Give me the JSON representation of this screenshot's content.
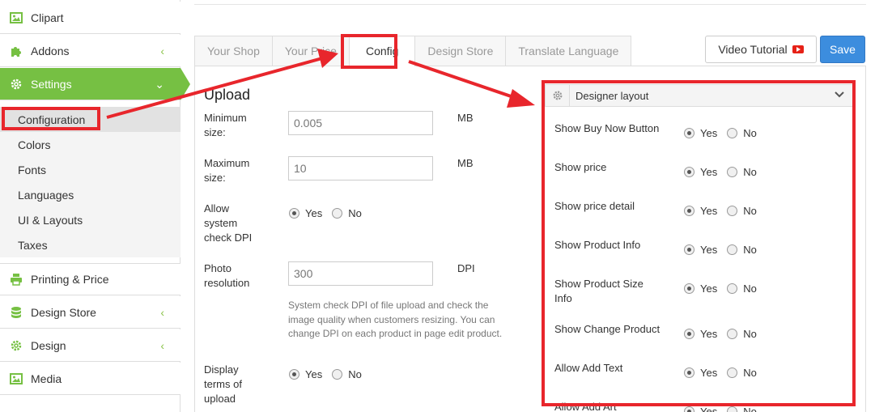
{
  "sidebar": {
    "items": [
      {
        "label": "Clipart",
        "icon": "image-icon"
      },
      {
        "label": "Addons",
        "icon": "puzzle-icon"
      },
      {
        "label": "Settings",
        "icon": "gear-icon"
      },
      {
        "label": "Printing & Price",
        "icon": "printer-icon"
      },
      {
        "label": "Design Store",
        "icon": "database-icon"
      },
      {
        "label": "Design",
        "icon": "gear-icon"
      },
      {
        "label": "Media",
        "icon": "image-icon"
      }
    ],
    "sub_items": [
      "Configuration",
      "Colors",
      "Fonts",
      "Languages",
      "UI & Layouts",
      "Taxes"
    ]
  },
  "tabs": [
    "Your Shop",
    "Your Price",
    "Config",
    "Design Store",
    "Translate Language"
  ],
  "header": {
    "video_label": "Video Tutorial",
    "save_label": "Save"
  },
  "upload": {
    "title": "Upload",
    "min_label": "Minimum size:",
    "min_value": "0.005",
    "max_label": "Maximum size:",
    "max_value": "10",
    "unit_mb": "MB",
    "dpi_label": "Allow system check DPI",
    "photo_label": "Photo resolution",
    "photo_value": "300",
    "unit_dpi": "DPI",
    "help": "System check DPI of file upload and check the image quality when customers resizing. You can change DPI on each product in page edit product.",
    "terms_label": "Display terms of upload",
    "yes": "Yes",
    "no": "No"
  },
  "designer_layout": {
    "title": "Designer layout",
    "options": [
      "Show Buy Now Button",
      "Show price",
      "Show price detail",
      "Show Product Info",
      "Show Product Size Info",
      "Show Change Product",
      "Allow Add Text",
      "Allow Add Art"
    ],
    "yes": "Yes",
    "no": "No"
  },
  "colors": {
    "accent": "#76c043",
    "primary": "#3c8dde",
    "annotation": "#e8262c"
  }
}
